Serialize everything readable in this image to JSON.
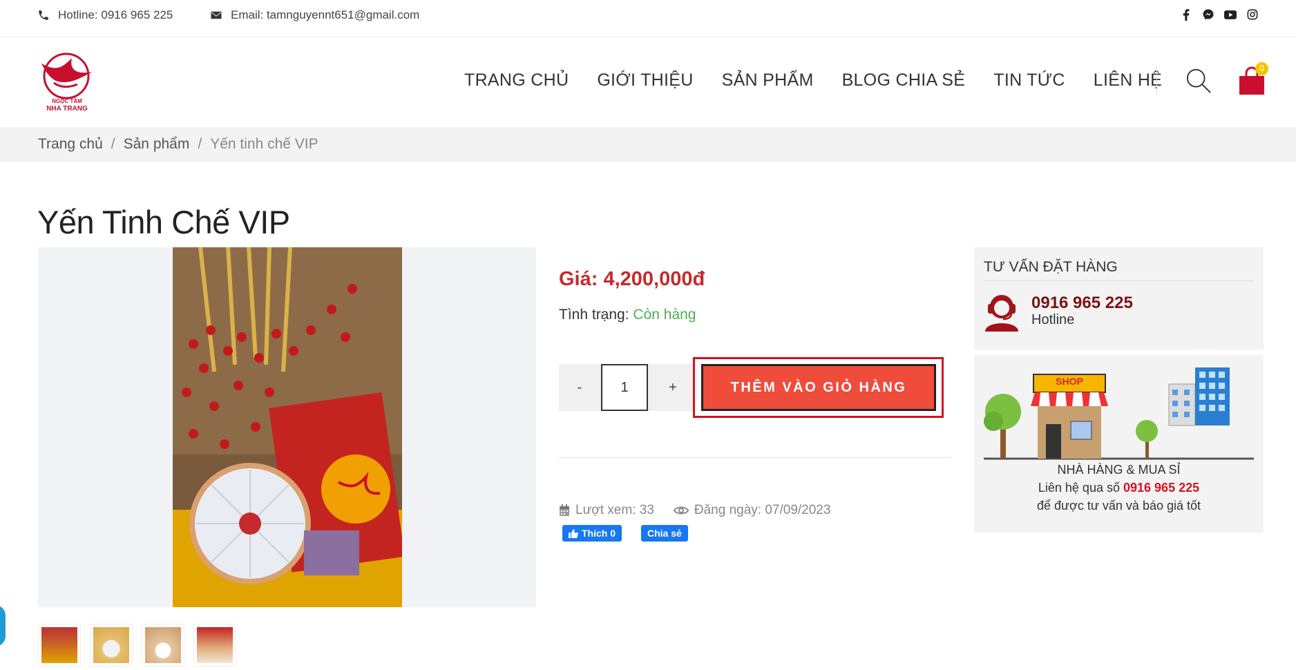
{
  "topbar": {
    "hotline": "Hotline: 0916 965 225",
    "email": "Email: tamnguyennt651@gmail.com",
    "social": [
      "facebook-icon",
      "messenger-icon",
      "youtube-icon",
      "instagram-icon"
    ]
  },
  "logo": {
    "line1": "NGỌC TÂM",
    "line2": "NHA TRANG"
  },
  "nav": [
    "TRANG CHỦ",
    "GIỚI THIỆU",
    "SẢN PHẨM",
    "BLOG CHIA SẺ",
    "TIN TỨC",
    "LIÊN HỆ"
  ],
  "cart": {
    "count": "0"
  },
  "breadcrumb": {
    "home": "Trang chủ",
    "cat": "Sản phẩm",
    "current": "Yến tinh chế VIP",
    "sep": "/"
  },
  "product": {
    "title": "Yến Tinh Chế VIP",
    "price": "Giá: 4,200,000đ",
    "status_label": "Tình trạng:",
    "status_value": "Còn hàng",
    "qty_minus": "-",
    "qty_value": "1",
    "qty_plus": "+",
    "add_to_cart": "THÊM VÀO GIỎ HÀNG",
    "views": "Lượt xem: 33",
    "posted": "Đăng ngày: 07/09/2023",
    "fb_like": "Thích 0",
    "fb_share": "Chia sẻ"
  },
  "sidebar": {
    "consult_title": "TƯ VẤN ĐẶT HÀNG",
    "phone": "0916 965 225",
    "hotline_label": "Hotline",
    "shop_sign": "SHOP",
    "wholesale_title": "NHÀ HÀNG & MUA SỈ",
    "contact_prefix": "Liên hệ qua số",
    "contact_phone": "0916 965 225",
    "contact_suffix": "để được tư vấn và báo giá tốt"
  },
  "colors": {
    "accent": "#c62a2e",
    "button": "#ef4c3c",
    "stock": "#4caf50",
    "dark_red": "#7a1412"
  }
}
